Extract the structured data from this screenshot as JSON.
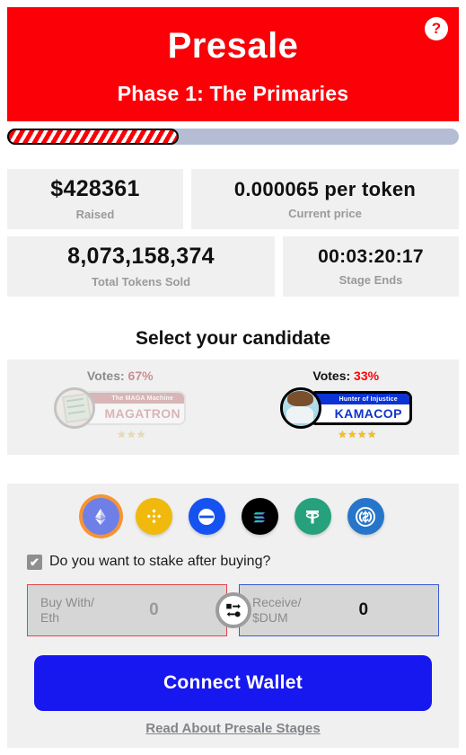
{
  "header": {
    "title": "Presale",
    "subtitle": "Phase 1: The Primaries",
    "help_icon": "question-mark-icon",
    "help_label": "?",
    "bg_color": "#fb0007"
  },
  "progress": {
    "percent": 38,
    "fill_color": "#fb0007",
    "track_color": "#b4bdd4"
  },
  "stats": [
    {
      "value": "$428361",
      "label": "Raised"
    },
    {
      "value": "0.000065 per token",
      "label": "Current price"
    },
    {
      "value": "8,073,158,374",
      "label": "Total Tokens Sold"
    },
    {
      "value": "00:03:20:17",
      "label": "Stage Ends"
    }
  ],
  "candidates_section": {
    "title": "Select your candidate",
    "items": [
      {
        "votes_label": "Votes:",
        "votes_value": "67%",
        "tagline": "The MAGA Machine",
        "name": "MAGATRON",
        "stars": "★★★",
        "selected": false,
        "accent": "#ef6068"
      },
      {
        "votes_label": "Votes:",
        "votes_value": "33%",
        "tagline": "Hunter of Injustice",
        "name": "KAMACOP",
        "stars": "★★★★",
        "selected": true,
        "accent": "#1133cc"
      }
    ]
  },
  "buy": {
    "coins": [
      {
        "name": "ethereum-icon",
        "symbol": "ETH",
        "selected": true,
        "color": "#6f7fe8"
      },
      {
        "name": "bnb-icon",
        "symbol": "BNB",
        "selected": false,
        "color": "#f0b90b"
      },
      {
        "name": "base-icon",
        "symbol": "BASE",
        "selected": false,
        "color": "#1652f0"
      },
      {
        "name": "solana-icon",
        "symbol": "SOL",
        "selected": false,
        "color": "#000000"
      },
      {
        "name": "tether-icon",
        "symbol": "USDT",
        "selected": false,
        "color": "#26a17b"
      },
      {
        "name": "usdc-icon",
        "symbol": "USDC",
        "selected": false,
        "color": "#2775ca"
      }
    ],
    "stake_checked": true,
    "stake_check_glyph": "✔",
    "stake_label": "Do you want to stake after buying?",
    "pay_label": "Buy With/\nEth",
    "pay_label_line1": "Buy With/",
    "pay_label_line2": "Eth",
    "pay_value": "0",
    "receive_label_line1": "Receive/",
    "receive_label_line2": "$DUM",
    "receive_value": "0",
    "swap_icon": "swap-arrows-icon",
    "connect_label": "Connect Wallet",
    "read_link": "Read About Presale Stages"
  }
}
